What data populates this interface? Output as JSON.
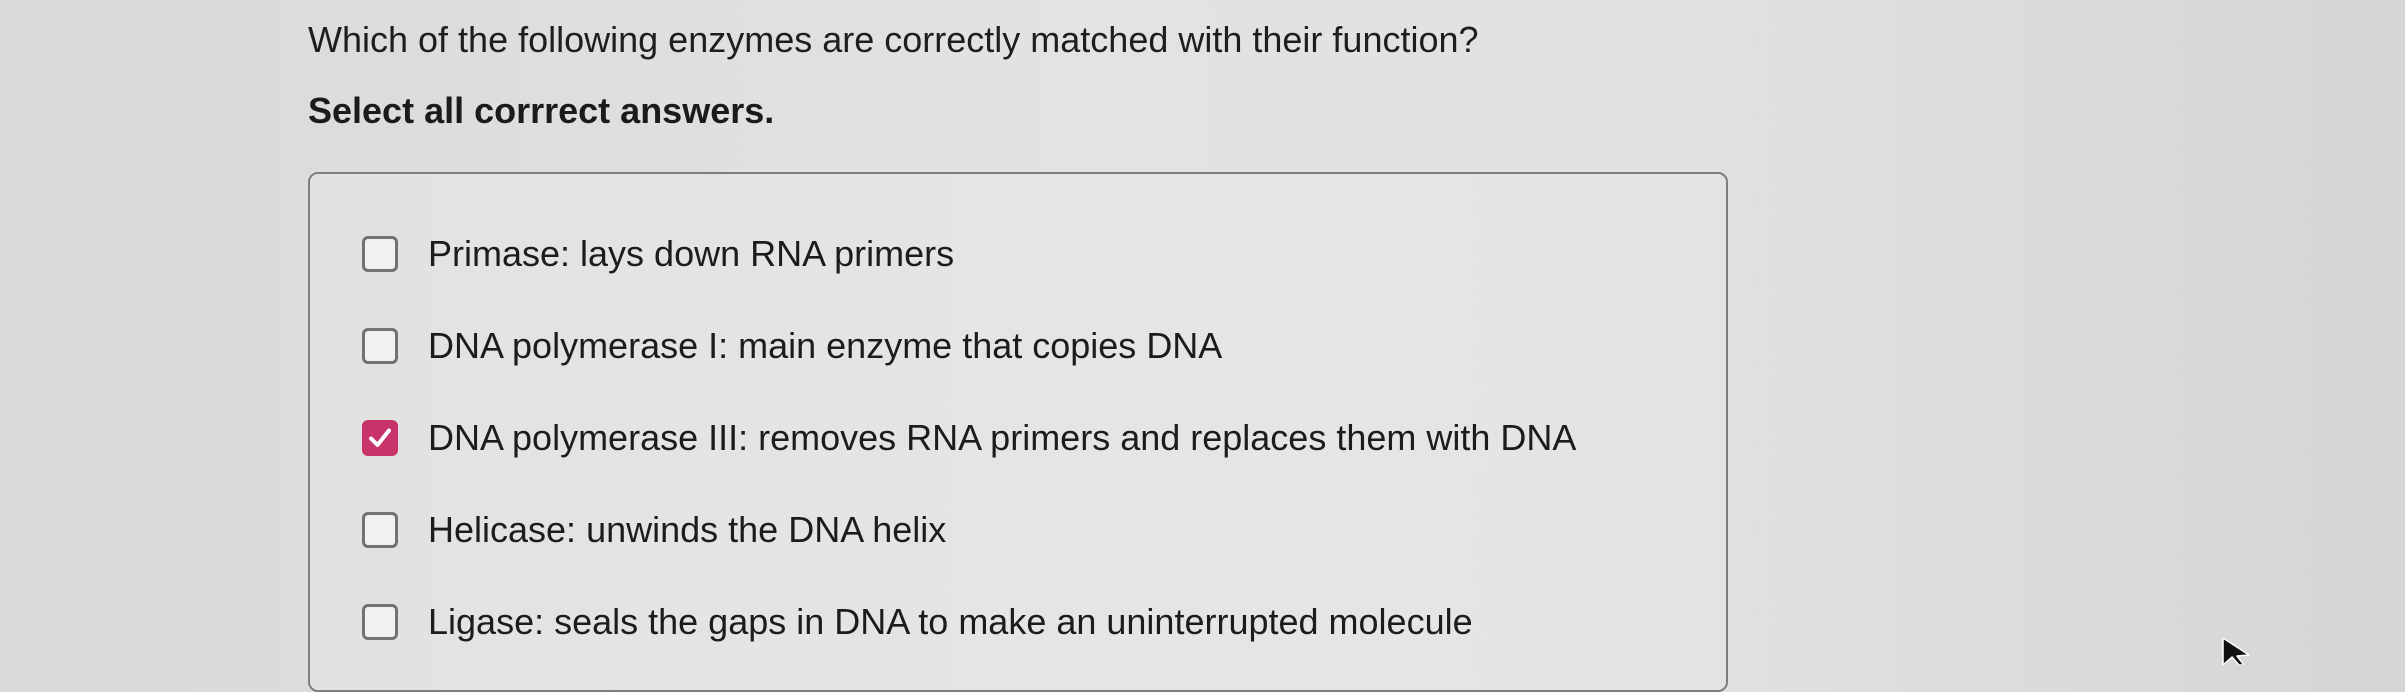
{
  "question": {
    "text": "Which of the following enzymes are correctly matched with their function?",
    "instruction": "Select all corrrect answers."
  },
  "options": [
    {
      "label": "Primase: lays down RNA primers",
      "checked": false
    },
    {
      "label": "DNA polymerase I: main enzyme that copies DNA",
      "checked": false
    },
    {
      "label": "DNA polymerase III: removes RNA primers and replaces them with DNA",
      "checked": true
    },
    {
      "label": "Helicase: unwinds the DNA helix",
      "checked": false
    },
    {
      "label": "Ligase: seals the gaps in DNA to make an uninterrupted molecule",
      "checked": false
    }
  ],
  "colors": {
    "checked_accent": "#c8336a",
    "checkbox_border": "#727272",
    "box_border": "#7e7e7e"
  },
  "icons": {
    "check": "checkmark-icon",
    "pointer": "mouse-cursor-icon"
  }
}
